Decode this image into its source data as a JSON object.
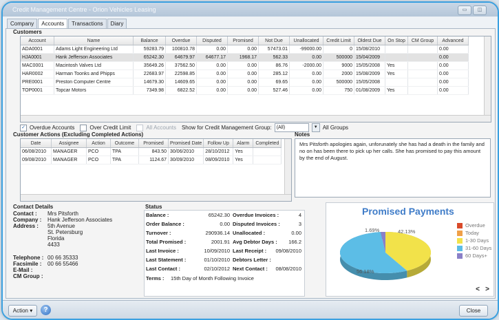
{
  "window": {
    "title": "Credit Management Centre - Orion Vehicles Leasing"
  },
  "tabs": [
    "Company",
    "Accounts",
    "Transactions",
    "Diary"
  ],
  "customers": {
    "section_title": "Customers",
    "columns": [
      "Account",
      "Name",
      "Balance",
      "Overdue",
      "Disputed",
      "Promised",
      "Not Due",
      "Unallocated",
      "Credit Limit",
      "Oldest Due",
      "On Stop",
      "CM Group",
      "Advanced"
    ],
    "rows": [
      [
        "ADA0001",
        "Adams Light Engineering Ltd",
        "59283.79",
        "100810.78",
        "0.00",
        "0.00",
        "57473.01",
        "-99000.00",
        "0",
        "15/08/2010",
        "",
        "",
        "0.00"
      ],
      [
        "HJA0001",
        "Hank Jefferson Associates",
        "65242.30",
        "64679.97",
        "64677.17",
        "1968.17",
        "562.33",
        "0.00",
        "500000",
        "15/04/2009",
        "",
        "",
        "0.00"
      ],
      [
        "MAC0001",
        "Macintosh Valves Ltd",
        "35649.26",
        "37562.50",
        "0.00",
        "0.00",
        "86.76",
        "-2000.00",
        "9000",
        "15/05/2008",
        "Yes",
        "",
        "0.00"
      ],
      [
        "HAR0002",
        "Harman Toonks and Phipps",
        "22683.97",
        "22598.85",
        "0.00",
        "0.00",
        "285.12",
        "0.00",
        "2000",
        "15/08/2009",
        "Yes",
        "",
        "0.00"
      ],
      [
        "PRE0001",
        "Preston Computer Centre",
        "14679.30",
        "14609.65",
        "0.00",
        "0.00",
        "69.65",
        "0.00",
        "500000",
        "15/05/2008",
        "",
        "",
        "0.00"
      ],
      [
        "TOP0001",
        "Topcar Motors",
        "7349.98",
        "6822.52",
        "0.00",
        "0.00",
        "527.46",
        "0.00",
        "750",
        "01/08/2009",
        "Yes",
        "",
        "0.00"
      ]
    ],
    "selected_row": 1
  },
  "filters": {
    "overdue_accounts": "Overdue Accounts",
    "over_credit_limit": "Over Credit Limit",
    "all_accounts": "All Accounts",
    "show_label": "Show for Credit Management Group:",
    "group_value": "(All)",
    "all_groups": "All Groups"
  },
  "actions": {
    "section_title": "Customer Actions (Excluding Completed Actions)",
    "columns": [
      "Date",
      "Assignee",
      "Action",
      "Outcome",
      "Promised",
      "Promised Date",
      "Follow Up",
      "Alarm",
      "Completed"
    ],
    "rows": [
      [
        "06/08/2010",
        "MANAGER",
        "PCO",
        "TPA",
        "843.50",
        "30/06/2010",
        "28/10/2012",
        "Yes",
        ""
      ],
      [
        "09/08/2010",
        "MANAGER",
        "PCO",
        "TPA",
        "1124.67",
        "30/09/2010",
        "08/09/2010",
        "Yes",
        ""
      ]
    ]
  },
  "notes": {
    "section_title": "Notes",
    "text": "Mrs Pitsforth apologies again, unforunately she has had a death in the family and no on has been there to pick up her calls. She has promised to pay this amount by the end of August."
  },
  "contact": {
    "section_title": "Contact Details",
    "contact_label": "Contact :",
    "contact": "Mrs Pitsforth",
    "company_label": "Company :",
    "company": "Hank Jefferson Associates",
    "address_label": "Address :",
    "address": [
      "5th Avenue",
      "St. Petersburg",
      "Florida",
      "4433"
    ],
    "telephone_label": "Telephone :",
    "telephone": "00 66 35333",
    "facsimile_label": "Facsimile :",
    "facsimile": "00 66 55466",
    "email_label": "E-Mail :",
    "email": "",
    "cmgroup_label": "CM Group :",
    "cmgroup": ""
  },
  "status": {
    "section_title": "Status",
    "balance_label": "Balance :",
    "balance": "65242.30",
    "order_balance_label": "Order Balance :",
    "order_balance": "0.00",
    "turnover_label": "Turnover :",
    "turnover": "290936.14",
    "total_promised_label": "Total Promised :",
    "total_promised": "2001.91",
    "last_invoice_label": "Last Invoice :",
    "last_invoice": "10/09/2010",
    "last_statement_label": "Last Statement :",
    "last_statement": "01/10/2010",
    "last_contact_label": "Last Contact :",
    "last_contact": "02/10/2012",
    "overdue_invoices_label": "Overdue Invoices :",
    "overdue_invoices": "4",
    "disputed_invoices_label": "Disputed Invoices :",
    "disputed_invoices": "3",
    "unallocated_label": "Unallocated :",
    "unallocated": "0.00",
    "avg_debtor_days_label": "Avg Debtor Days :",
    "avg_debtor_days": "166.2",
    "last_receipt_label": "Last Receipt :",
    "last_receipt": "09/08/2010",
    "debtors_letter_label": "Debtors Letter :",
    "debtors_letter": "",
    "next_contact_label": "Next Contact :",
    "next_contact": "08/08/2010",
    "terms_label": "Terms :",
    "terms": "15th Day of Month Following Invoice"
  },
  "chart_data": {
    "type": "pie",
    "title": "Promised Payments",
    "categories": [
      "Overdue",
      "Today",
      "1-30 Days",
      "31-60 Days",
      "60 Days+"
    ],
    "colors": [
      "#d94a2a",
      "#f0a048",
      "#f2e24a",
      "#5cbde6",
      "#8a80c8"
    ],
    "values": [
      0,
      0,
      42.13,
      56.18,
      1.69
    ],
    "data_labels": [
      "1.69%",
      "42.13%",
      "56.18%"
    ],
    "nav_prev": "<",
    "nav_next": ">"
  },
  "footer": {
    "action_label": "Action",
    "close_label": "Close"
  }
}
